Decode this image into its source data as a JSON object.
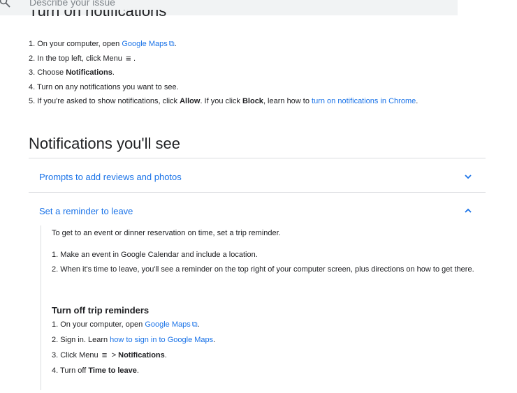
{
  "search": {
    "placeholder": "Describe your issue"
  },
  "top_heading": "Turn on notifications",
  "steps": [
    {
      "pre": "1. On your computer, open ",
      "link": "Google Maps",
      "post": "."
    },
    {
      "pre": "2. In the top left, click Menu ",
      "post": "."
    },
    {
      "pre": "3. Choose ",
      "bold": "Notifications",
      "post": "."
    },
    {
      "pre": "4. Turn on any notifications you want to see."
    },
    {
      "pre": "5. If you're asked to show notifications, click ",
      "bold1": "Allow",
      "mid": ". If you click ",
      "bold2": "Block",
      "mid2": ", learn how to ",
      "link": "turn on notifications in Chrome",
      "post": "."
    }
  ],
  "section_title": "Notifications you'll see",
  "accordion": [
    {
      "label": "Prompts to add reviews and photos",
      "expanded": false
    },
    {
      "label": "Set a reminder to leave",
      "expanded": true
    }
  ],
  "reminder": {
    "intro": "To get to an event or dinner reservation on time, set a trip reminder.",
    "steps": [
      "1. Make an event in Google Calendar and include a location.",
      "2. When it's time to leave, you'll see a reminder on the top right of your computer screen, plus directions on how to get there."
    ],
    "off_heading": "Turn off trip reminders",
    "off_steps": [
      {
        "pre": "1. On your computer, open ",
        "link": "Google Maps",
        "post": "."
      },
      {
        "pre": "2. Sign in. Learn ",
        "link": "how to sign in to Google Maps",
        "post": "."
      },
      {
        "pre": "3. Click Menu ",
        "arrow": ">",
        "bold": "Notifications",
        "post": "."
      },
      {
        "pre": "4. Turn off ",
        "bold": "Time to leave",
        "post": "."
      }
    ]
  },
  "colors": {
    "link": "#1a73e8",
    "divider": "#dadce0",
    "search_bg": "#f1f3f4"
  },
  "icons": {
    "search": "search-icon",
    "external": "external-link-icon",
    "menu": "menu-icon",
    "chevron_down": "chevron-down-icon",
    "chevron_up": "chevron-up-icon"
  }
}
